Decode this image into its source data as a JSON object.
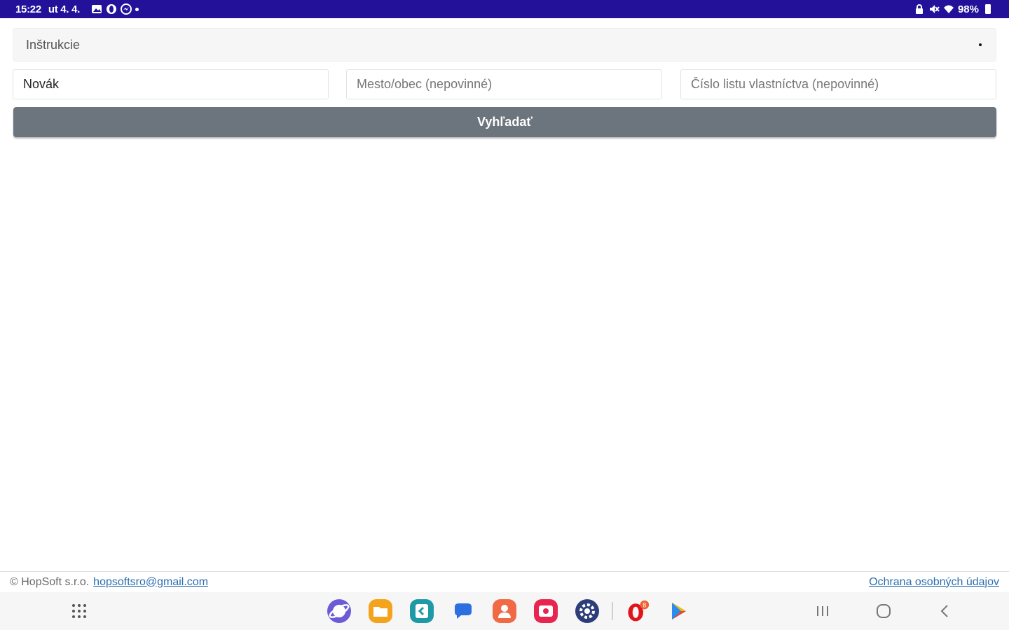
{
  "status_bar": {
    "time": "15:22",
    "date": "ut 4. 4.",
    "battery": "98%",
    "left_icons": [
      "gallery-icon",
      "opera-icon",
      "messenger-icon",
      "dot-icon"
    ],
    "right_icons": [
      "lock-icon",
      "mute-icon",
      "wifi-icon",
      "battery-icon"
    ],
    "background": "#23119a"
  },
  "instructions": {
    "label": "Inštrukcie"
  },
  "form": {
    "name_value": "Novák",
    "city_placeholder": "Mesto/obec (nepovinné)",
    "lv_placeholder": "Číslo listu vlastníctva (nepovinné)",
    "search_label": "Vyhľadať",
    "button_color": "#6c757d"
  },
  "footer": {
    "copyright": "© HopSoft s.r.o.",
    "email": "hopsoftsro@gmail.com",
    "privacy": "Ochrana osobných údajov",
    "link_color": "#2a6fb0"
  },
  "nav_bar": {
    "apps": [
      "internet-app-icon",
      "my-files-app-icon",
      "calendar-app-icon",
      "messages-app-icon",
      "contacts-app-icon",
      "screen-recorder-app-icon",
      "settings-app-icon",
      "opera-app-icon",
      "play-store-app-icon"
    ],
    "opera_badge": "8",
    "buttons": [
      "recents-button",
      "home-button",
      "back-button"
    ]
  }
}
